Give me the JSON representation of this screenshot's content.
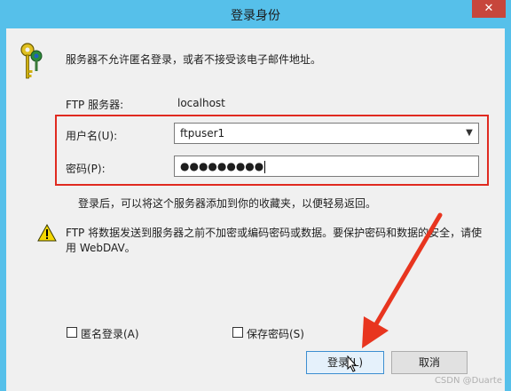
{
  "window": {
    "title": "登录身份",
    "close_label": "✕"
  },
  "message": {
    "no_anonymous": "服务器不允许匿名登录，或者不接受该电子邮件地址。"
  },
  "server": {
    "label": "FTP 服务器:",
    "value": "localhost"
  },
  "username": {
    "label": "用户名(U):",
    "value": "ftpuser1"
  },
  "password": {
    "label": "密码(P):",
    "masked": "●●●●●●●●●"
  },
  "hint": "登录后，可以将这个服务器添加到你的收藏夹，以便轻易返回。",
  "warning": {
    "line1": "FTP 将数据发送到服务器之前不加密或编码密码或数据。要保护密码和数据的安全，请使",
    "line2": "用 WebDAV。"
  },
  "options": {
    "anonymous_label": "匿名登录(A)",
    "save_password_label": "保存密码(S)"
  },
  "buttons": {
    "login": "登录(L)",
    "cancel": "取消"
  },
  "watermark": "CSDN @Duarte",
  "colors": {
    "titlebar": "#56c0ea",
    "highlight": "#e02a20",
    "arrow": "#e8351f"
  },
  "icons": {
    "keys": "keys-icon",
    "warning": "warning-icon",
    "cursor": "mouse-pointer-icon"
  }
}
